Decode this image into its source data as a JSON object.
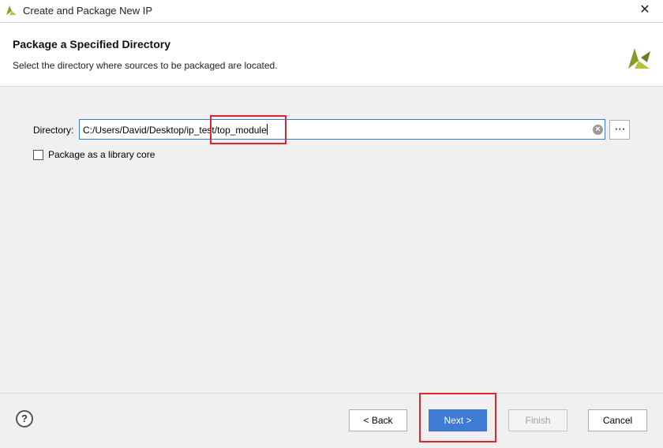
{
  "window": {
    "title": "Create and Package New IP",
    "app_icon": "vivado-logo-icon",
    "close_icon": "close-icon"
  },
  "header": {
    "title": "Package a Specified Directory",
    "subtitle": "Select the directory where sources to be packaged are located."
  },
  "form": {
    "directory_label": "Directory:",
    "directory_value": "C:/Users/David/Desktop/ip_test/top_module",
    "browse_label": "⋯",
    "clear_label": "×",
    "library_core_label": "Package as a library core",
    "library_core_checked": false
  },
  "footer": {
    "help_label": "?",
    "back_label": "< Back",
    "next_label": "Next >",
    "finish_label": "Finish",
    "cancel_label": "Cancel"
  },
  "colors": {
    "accent": "#3d7bd4",
    "highlight": "#e0242c",
    "logo": "#8a9a2a"
  }
}
